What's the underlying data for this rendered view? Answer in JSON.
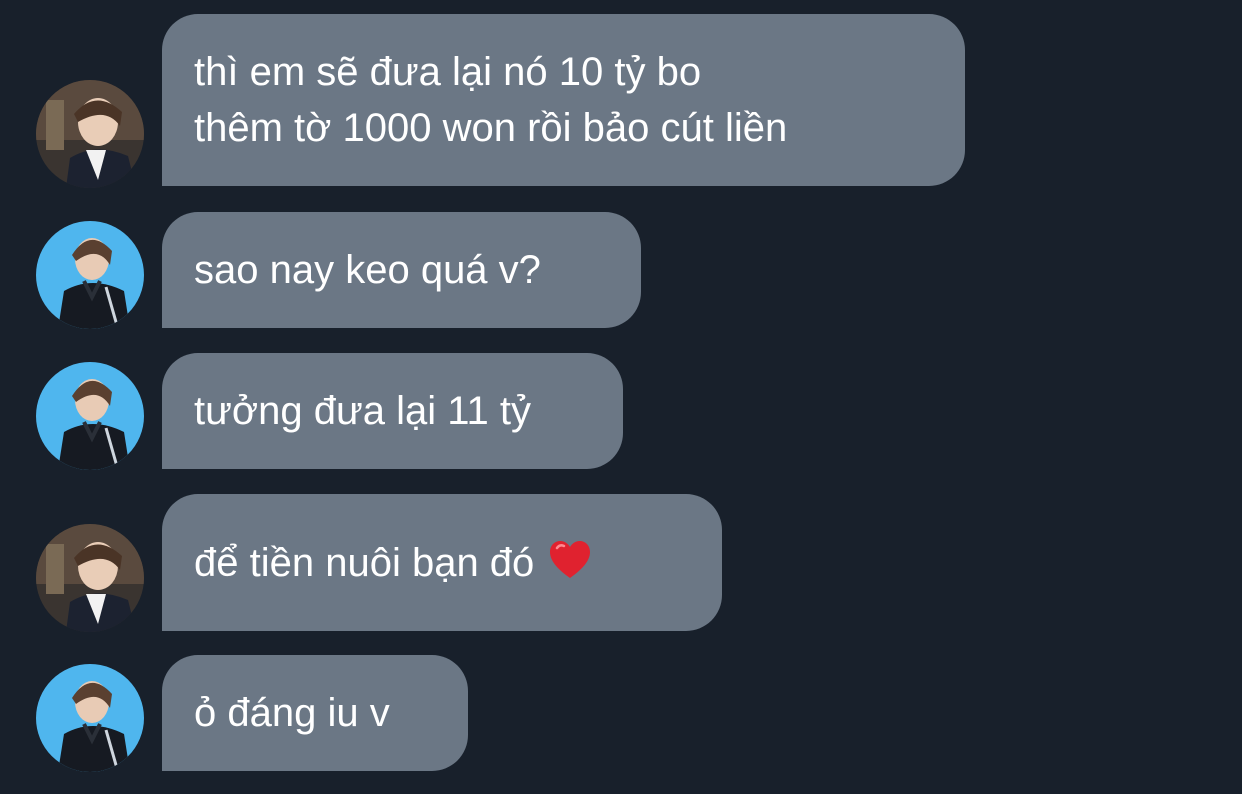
{
  "messages": [
    {
      "sender": "user-a",
      "lines": [
        "thì em sẽ đưa lại nó 10 tỷ bo",
        "thêm tờ 1000 won rồi bảo cút liền"
      ]
    },
    {
      "sender": "user-b",
      "lines": [
        "sao nay keo quá v?"
      ]
    },
    {
      "sender": "user-b",
      "lines": [
        "tưởng đưa lại 11 tỷ"
      ]
    },
    {
      "sender": "user-a",
      "lines": [
        "để tiền nuôi bạn đó"
      ],
      "emoji": "heart-emoji"
    },
    {
      "sender": "user-b",
      "lines": [
        "ỏ đáng iu v"
      ]
    }
  ],
  "colors": {
    "background": "#18202b",
    "bubble": "#6b7785",
    "text": "#ffffff",
    "avatar_b_bg": "#4fb6ee",
    "heart": "#e0222f"
  }
}
